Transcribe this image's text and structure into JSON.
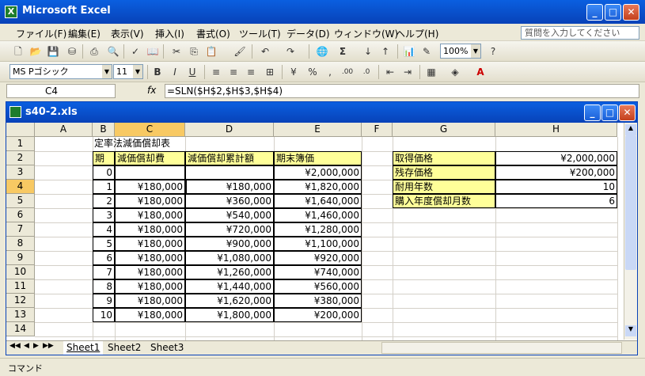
{
  "app": {
    "title": "Microsoft Excel"
  },
  "menu": {
    "items": [
      "ファイル(F)",
      "編集(E)",
      "表示(V)",
      "挿入(I)",
      "書式(O)",
      "ツール(T)",
      "データ(D)",
      "ウィンドウ(W)",
      "ヘルプ(H)"
    ],
    "help_placeholder": "質問を入力してください"
  },
  "toolbar": {
    "zoom": "100%",
    "font_name": "MS Pゴシック",
    "font_size": "11"
  },
  "formula_bar": {
    "cell_ref": "C4",
    "fx": "fx",
    "formula": "=SLN($H$2,$H$3,$H$4)"
  },
  "workbook": {
    "title": "s40-2.xls"
  },
  "columns": [
    "A",
    "B",
    "C",
    "D",
    "E",
    "F",
    "G",
    "H"
  ],
  "rows": [
    "1",
    "2",
    "3",
    "4",
    "5",
    "6",
    "7",
    "8",
    "9",
    "10",
    "11",
    "12",
    "13",
    "14"
  ],
  "sheet": {
    "title": "定率法減価償却表",
    "headers": [
      "期",
      "減価償却費",
      "減価償却累計額",
      "期末簿価"
    ],
    "table": [
      [
        "0",
        "",
        "",
        "¥2,000,000"
      ],
      [
        "1",
        "¥180,000",
        "¥180,000",
        "¥1,820,000"
      ],
      [
        "2",
        "¥180,000",
        "¥360,000",
        "¥1,640,000"
      ],
      [
        "3",
        "¥180,000",
        "¥540,000",
        "¥1,460,000"
      ],
      [
        "4",
        "¥180,000",
        "¥720,000",
        "¥1,280,000"
      ],
      [
        "5",
        "¥180,000",
        "¥900,000",
        "¥1,100,000"
      ],
      [
        "6",
        "¥180,000",
        "¥1,080,000",
        "¥920,000"
      ],
      [
        "7",
        "¥180,000",
        "¥1,260,000",
        "¥740,000"
      ],
      [
        "8",
        "¥180,000",
        "¥1,440,000",
        "¥560,000"
      ],
      [
        "9",
        "¥180,000",
        "¥1,620,000",
        "¥380,000"
      ],
      [
        "10",
        "¥180,000",
        "¥1,800,000",
        "¥200,000"
      ]
    ],
    "params": [
      [
        "取得価格",
        "¥2,000,000"
      ],
      [
        "残存価格",
        "¥200,000"
      ],
      [
        "耐用年数",
        "10"
      ],
      [
        "購入年度償却月数",
        "6"
      ]
    ]
  },
  "tabs": [
    "Sheet1",
    "Sheet2",
    "Sheet3"
  ],
  "status": {
    "text": "コマンド"
  }
}
